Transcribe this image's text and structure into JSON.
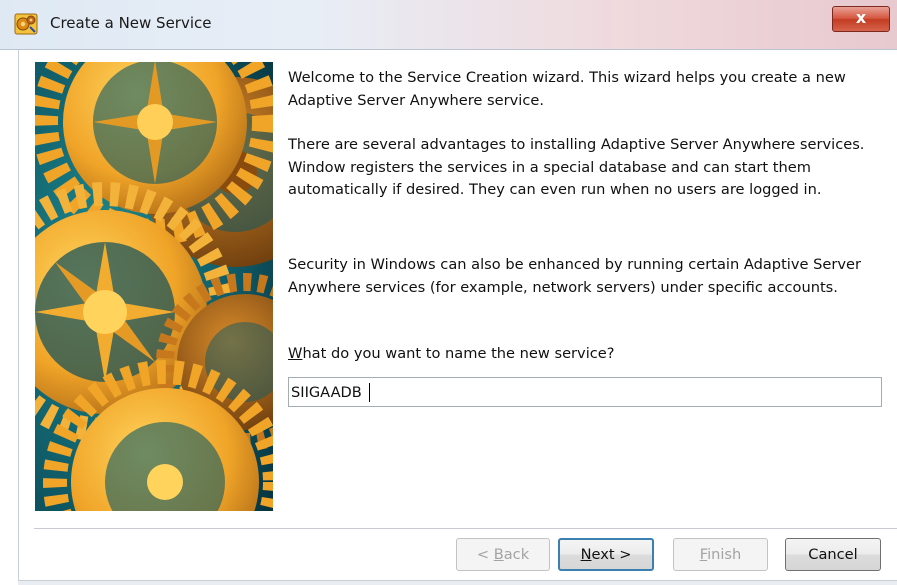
{
  "window": {
    "title": "Create a New Service",
    "close_glyph": "x",
    "icon": "sybase-gears-app-icon"
  },
  "banner": {
    "image": "golden-gears-illustration",
    "colors": {
      "background": "#0f5a66",
      "gear_gold": "#f0a428",
      "gear_shadow": "#9e5b12",
      "gear_dark": "#6a3a0a"
    }
  },
  "content": {
    "paragraph1": "Welcome to the Service Creation wizard. This wizard helps you create a new Adaptive Server Anywhere service.",
    "paragraph2": "There are several advantages to installing Adaptive Server Anywhere services. Window registers the services in a special database and can start them automatically if desired. They can even run when no users are logged in.",
    "paragraph3": "Security in Windows can also be enhanced by running certain Adaptive Server Anywhere services (for example, network servers) under specific accounts.",
    "question": {
      "mnemonic": "W",
      "rest": "hat do you want to name the new service?"
    },
    "service_name_value": "SIIGAADB"
  },
  "buttons": {
    "back": {
      "prefix": "< ",
      "mnemonic": "B",
      "rest": "ack",
      "enabled": false
    },
    "next": {
      "mnemonic": "N",
      "rest": "ext >",
      "enabled": true
    },
    "finish": {
      "mnemonic": "F",
      "rest": "inish",
      "enabled": false
    },
    "cancel": {
      "label": "Cancel",
      "enabled": true
    }
  }
}
